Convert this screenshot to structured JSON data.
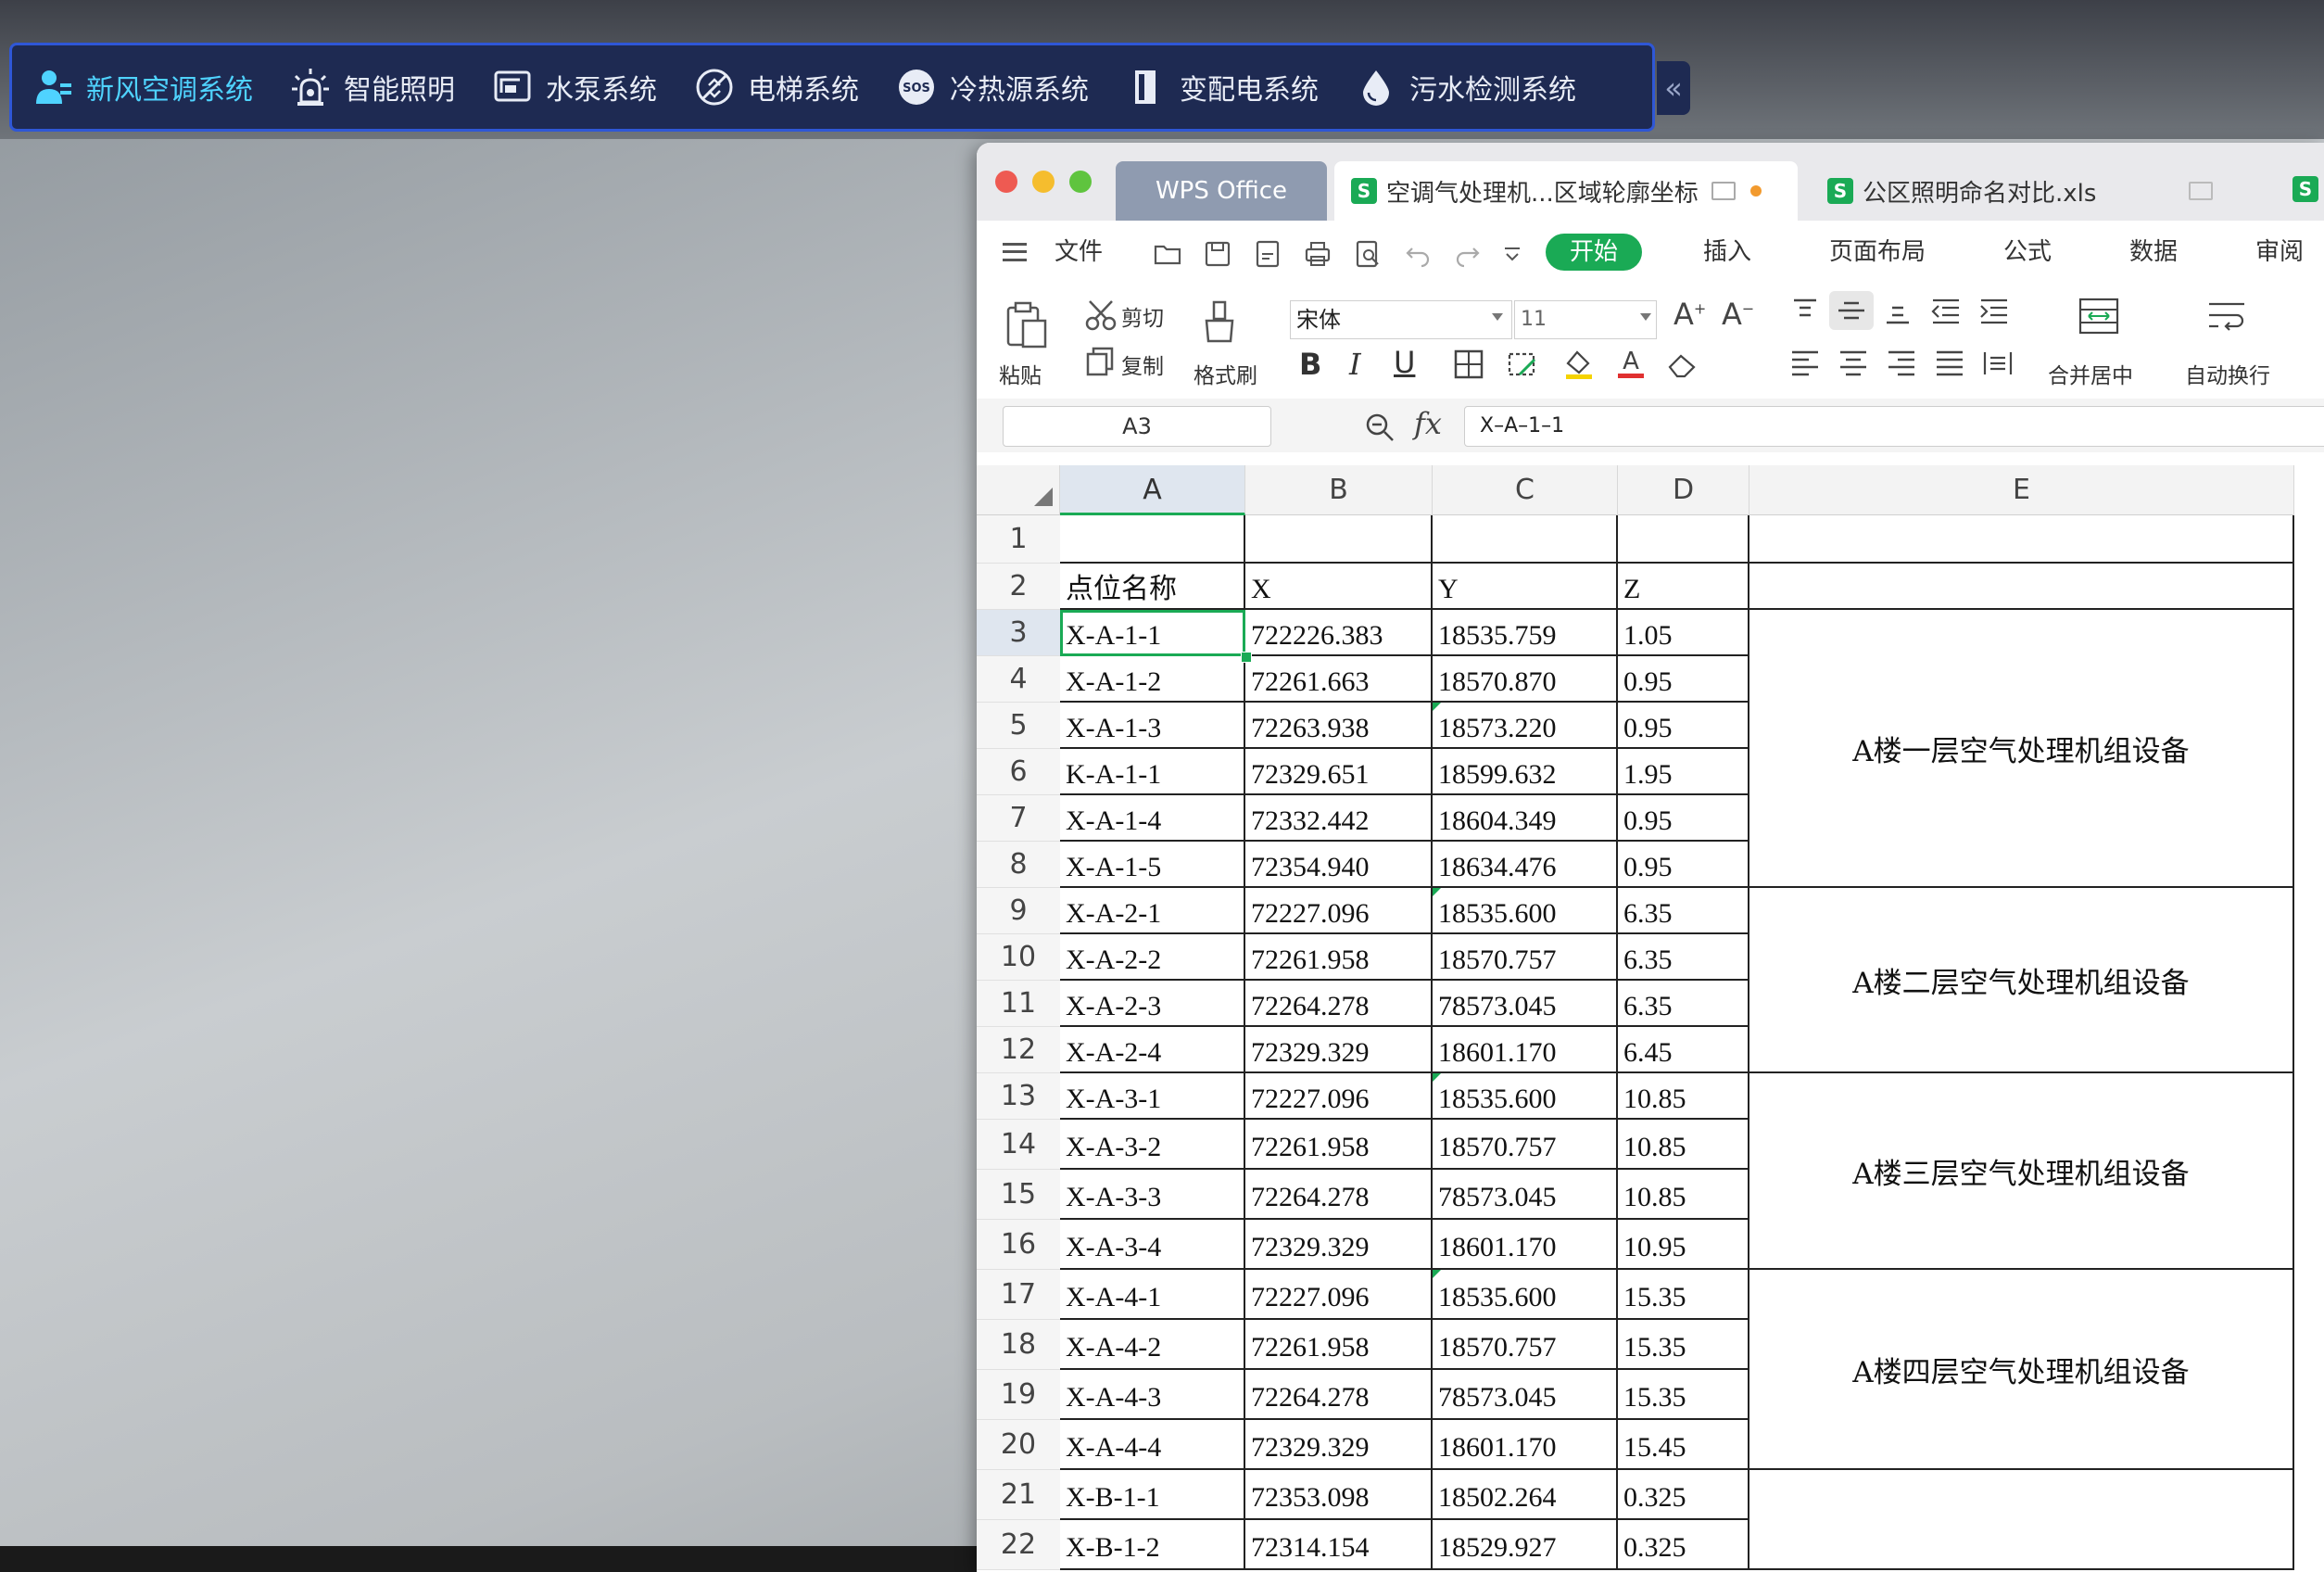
{
  "sysbar": {
    "items": [
      {
        "label": "新风空调系统",
        "icon": "user-group-icon",
        "active": true
      },
      {
        "label": "智能照明",
        "icon": "alarm-light-icon",
        "active": false
      },
      {
        "label": "水泵系统",
        "icon": "pump-monitor-icon",
        "active": false
      },
      {
        "label": "电梯系统",
        "icon": "elevator-icon",
        "active": false
      },
      {
        "label": "冷热源系统",
        "icon": "sos-icon",
        "active": false
      },
      {
        "label": "变配电系统",
        "icon": "power-cabinet-icon",
        "active": false
      },
      {
        "label": "污水检测系统",
        "icon": "water-drop-icon",
        "active": false
      }
    ],
    "collapse_glyph": "«",
    "active_color": "#4fd3ff"
  },
  "window": {
    "tabs": {
      "home": "WPS Office",
      "sheet1": "空调气处理机...区域轮廓坐标",
      "sheet2": "公区照明命名对比.xls",
      "sheet_icon": "S"
    },
    "menus": {
      "file": "文件",
      "start": "开始",
      "insert": "插入",
      "layout": "页面布局",
      "formula": "公式",
      "data": "数据",
      "review": "审阅"
    },
    "ribbon": {
      "paste": "粘贴",
      "cut": "剪切",
      "copy": "复制",
      "format_painter": "格式刷",
      "font": "宋体",
      "size": "11",
      "merge": "合并居中",
      "wrap": "自动换行",
      "bold": "B",
      "italic": "I",
      "underline": "U"
    },
    "formula": {
      "cell_ref": "A3",
      "fx": "fx",
      "value": "X–A–1–1"
    },
    "columns": [
      "A",
      "B",
      "C",
      "D",
      "E"
    ],
    "rows": [
      {
        "n": "1",
        "a": "",
        "b": "",
        "c": "",
        "d": ""
      },
      {
        "n": "2",
        "a": "点位名称",
        "b": "X",
        "c": "Y",
        "d": "Z"
      },
      {
        "n": "3",
        "a": "X-A-1-1",
        "b": "722226.383",
        "c": "18535.759",
        "d": "1.05"
      },
      {
        "n": "4",
        "a": "X-A-1-2",
        "b": "72261.663",
        "c": "18570.870",
        "d": "0.95"
      },
      {
        "n": "5",
        "a": "X-A-1-3",
        "b": "72263.938",
        "c": "18573.220",
        "d": "0.95"
      },
      {
        "n": "6",
        "a": "K-A-1-1",
        "b": "72329.651",
        "c": "18599.632",
        "d": "1.95"
      },
      {
        "n": "7",
        "a": "X-A-1-4",
        "b": "72332.442",
        "c": "18604.349",
        "d": "0.95"
      },
      {
        "n": "8",
        "a": "X-A-1-5",
        "b": "72354.940",
        "c": "18634.476",
        "d": "0.95"
      },
      {
        "n": "9",
        "a": "X-A-2-1",
        "b": "72227.096",
        "c": "18535.600",
        "d": "6.35"
      },
      {
        "n": "10",
        "a": "X-A-2-2",
        "b": "72261.958",
        "c": "18570.757",
        "d": "6.35"
      },
      {
        "n": "11",
        "a": "X-A-2-3",
        "b": "72264.278",
        "c": "78573.045",
        "d": "6.35"
      },
      {
        "n": "12",
        "a": "X-A-2-4",
        "b": "72329.329",
        "c": "18601.170",
        "d": "6.45"
      },
      {
        "n": "13",
        "a": "X-A-3-1",
        "b": "72227.096",
        "c": "18535.600",
        "d": "10.85"
      },
      {
        "n": "14",
        "a": "X-A-3-2",
        "b": "72261.958",
        "c": "18570.757",
        "d": "10.85"
      },
      {
        "n": "15",
        "a": "X-A-3-3",
        "b": "72264.278",
        "c": "78573.045",
        "d": "10.85"
      },
      {
        "n": "16",
        "a": "X-A-3-4",
        "b": "72329.329",
        "c": "18601.170",
        "d": "10.95"
      },
      {
        "n": "17",
        "a": "X-A-4-1",
        "b": "72227.096",
        "c": "18535.600",
        "d": "15.35"
      },
      {
        "n": "18",
        "a": "X-A-4-2",
        "b": "72261.958",
        "c": "18570.757",
        "d": "15.35"
      },
      {
        "n": "19",
        "a": "X-A-4-3",
        "b": "72264.278",
        "c": "78573.045",
        "d": "15.35"
      },
      {
        "n": "20",
        "a": "X-A-4-4",
        "b": "72329.329",
        "c": "18601.170",
        "d": "15.45"
      },
      {
        "n": "21",
        "a": "X-B-1-1",
        "b": "72353.098",
        "c": "18502.264",
        "d": "0.325"
      },
      {
        "n": "22",
        "a": "X-B-1-2",
        "b": "72314.154",
        "c": "18529.927",
        "d": "0.325"
      }
    ],
    "merged_e": [
      {
        "first_row": 3,
        "last_row": 8,
        "text": "A楼一层空气处理机组设备"
      },
      {
        "first_row": 9,
        "last_row": 12,
        "text": "A楼二层空气处理机组设备"
      },
      {
        "first_row": 13,
        "last_row": 16,
        "text": "A楼三层空气处理机组设备"
      },
      {
        "first_row": 17,
        "last_row": 20,
        "text": "A楼四层空气处理机组设备"
      },
      {
        "first_row": 21,
        "last_row": 22,
        "text": ""
      }
    ],
    "triangle_rows": [
      5,
      9,
      13,
      17
    ],
    "accent_color": "#1aaa55"
  }
}
